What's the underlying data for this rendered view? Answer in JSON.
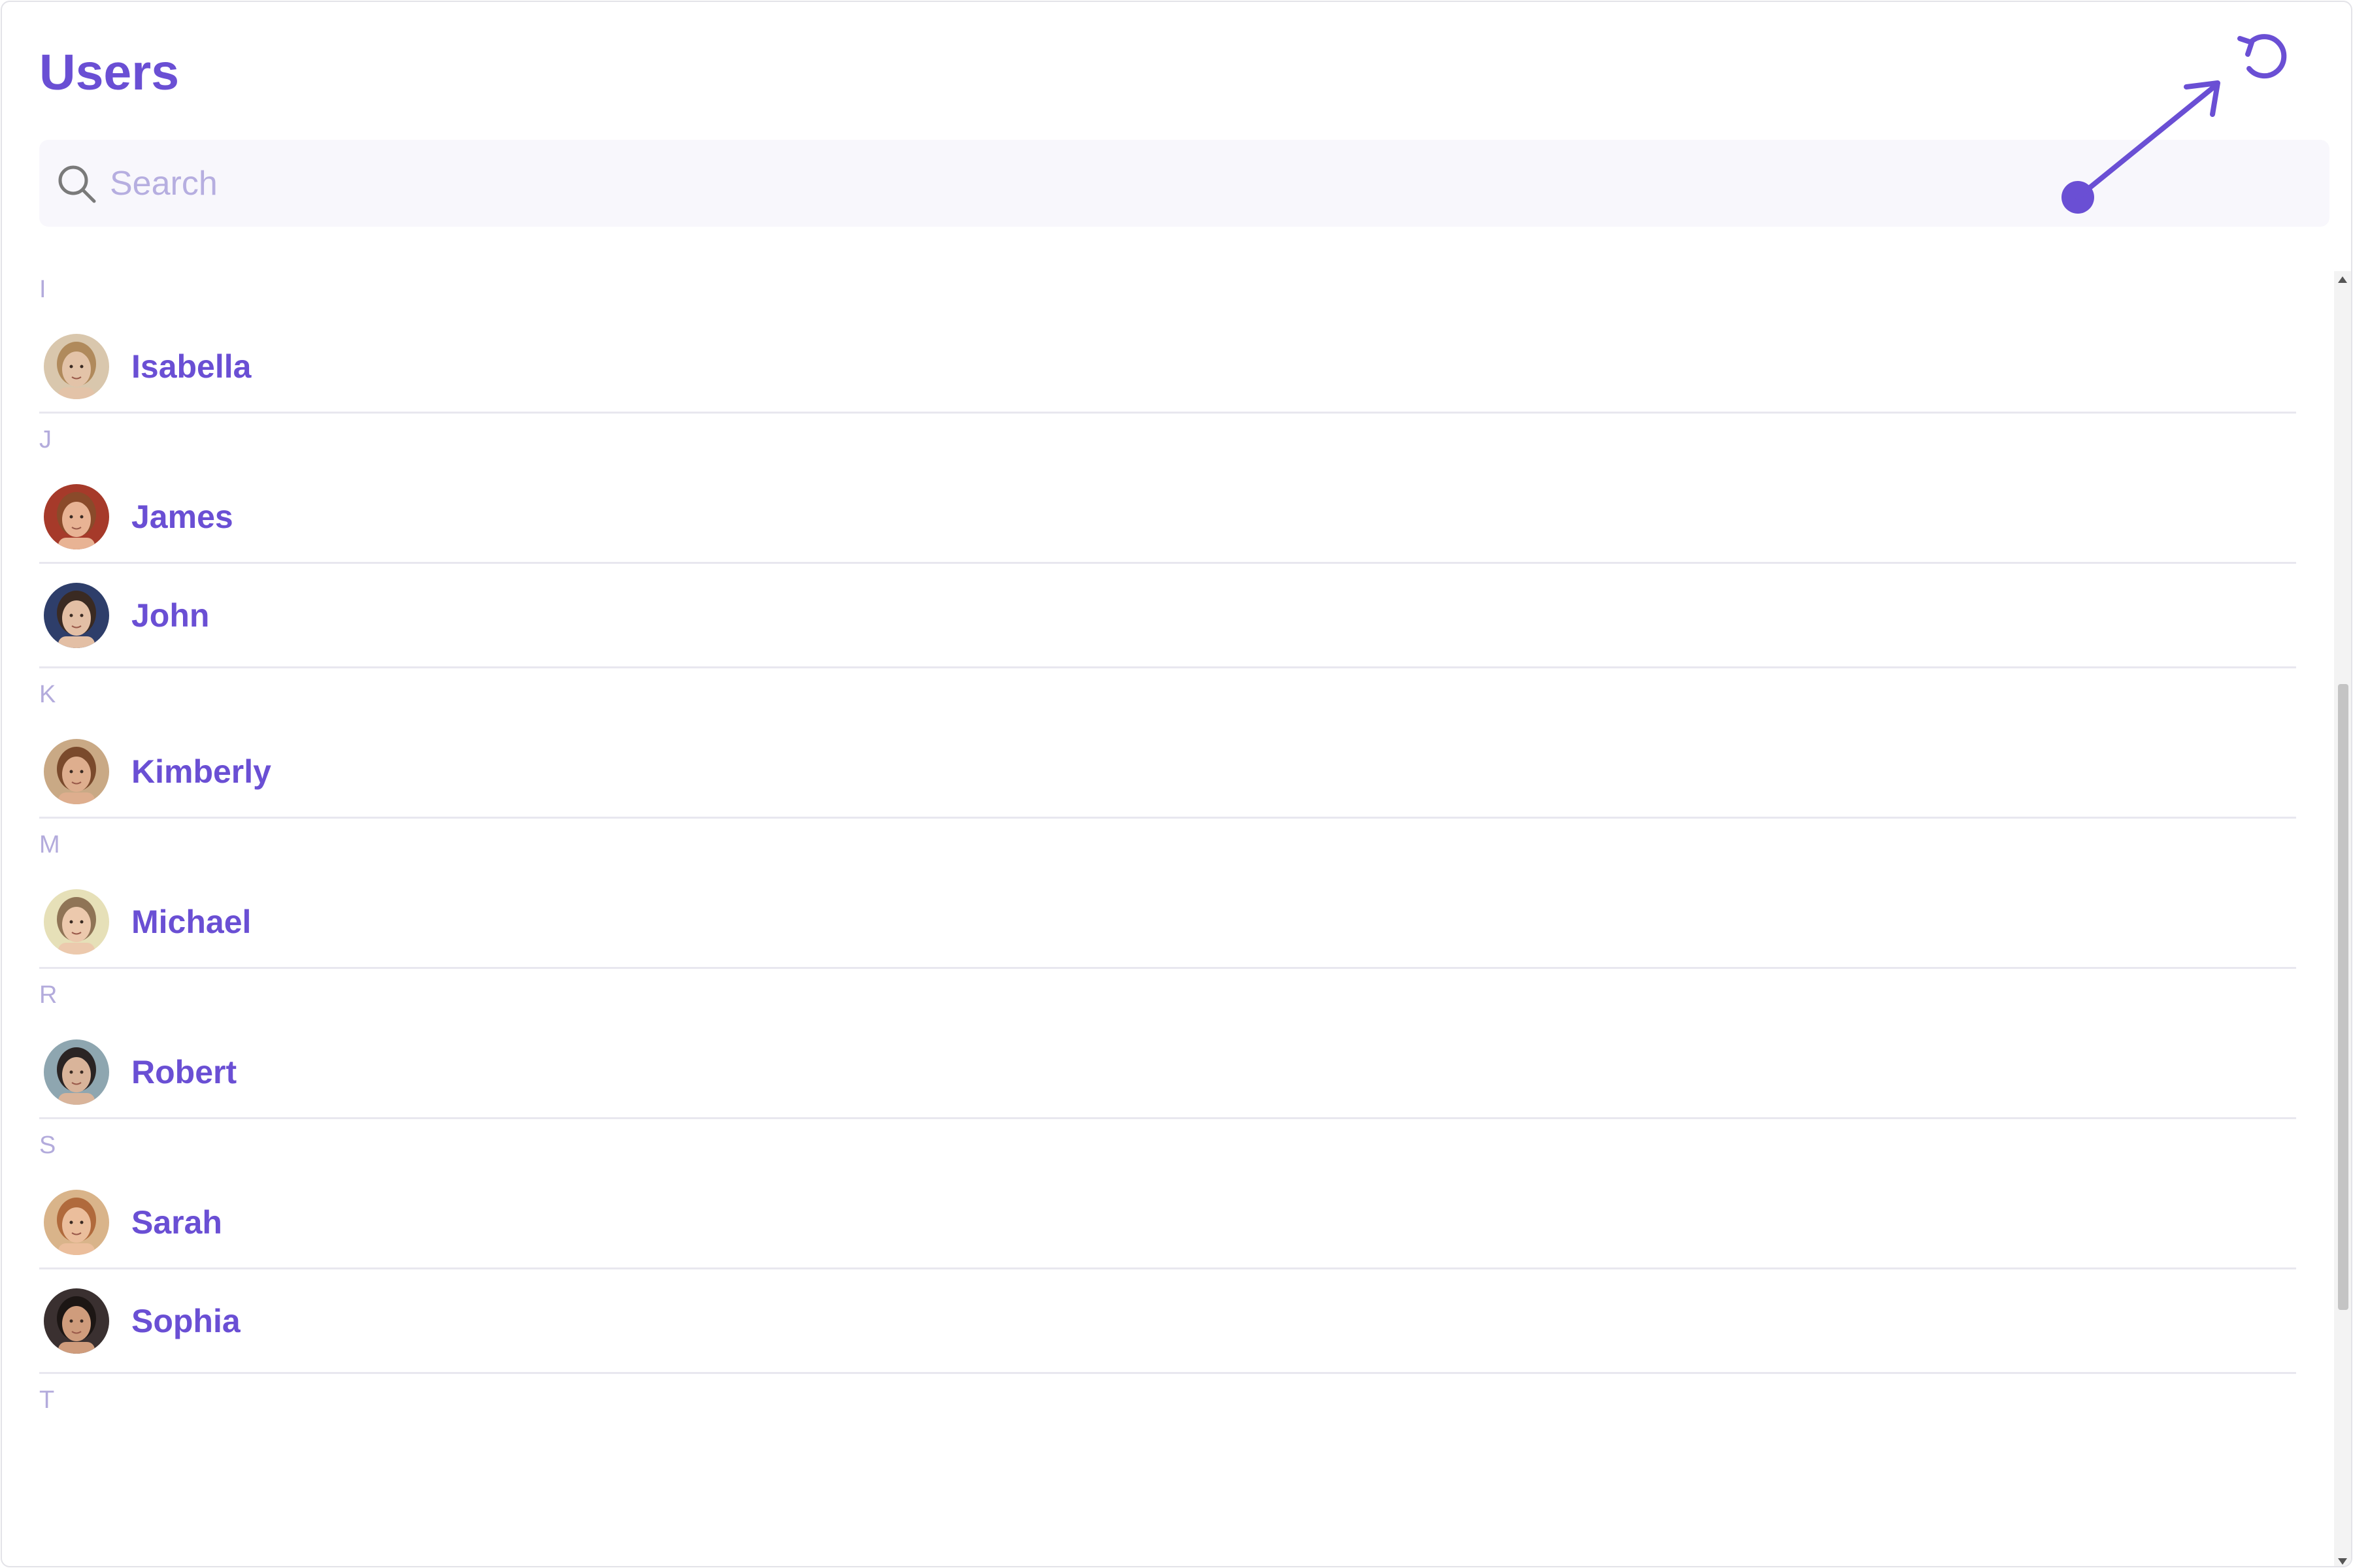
{
  "header": {
    "title": "Users",
    "refresh_icon": "refresh-icon"
  },
  "search": {
    "placeholder": "Search",
    "value": "",
    "icon": "search-icon"
  },
  "colors": {
    "accent": "#6a4fd4",
    "section_letter": "#b3abdc",
    "divider": "#e8e7ef",
    "search_bg": "#f8f7fc"
  },
  "sections": [
    {
      "letter": "I",
      "users": [
        {
          "name": "Isabella",
          "avatar": {
            "skin": "#e3c3a8",
            "hair": "#b08a5c",
            "bg": "#d9c7ad"
          }
        }
      ]
    },
    {
      "letter": "J",
      "users": [
        {
          "name": "James",
          "avatar": {
            "skin": "#e8b394",
            "hair": "#8a4a2a",
            "bg": "#a63a2a"
          }
        },
        {
          "name": "John",
          "avatar": {
            "skin": "#e3bfa5",
            "hair": "#3a2a22",
            "bg": "#2e3e6a"
          }
        }
      ]
    },
    {
      "letter": "K",
      "users": [
        {
          "name": "Kimberly",
          "avatar": {
            "skin": "#deae8e",
            "hair": "#7a4a2c",
            "bg": "#c9a985"
          }
        }
      ]
    },
    {
      "letter": "M",
      "users": [
        {
          "name": "Michael",
          "avatar": {
            "skin": "#ecc9ad",
            "hair": "#8f7456",
            "bg": "#e6e0b8"
          }
        }
      ]
    },
    {
      "letter": "R",
      "users": [
        {
          "name": "Robert",
          "avatar": {
            "skin": "#d9b49a",
            "hair": "#2a2424",
            "bg": "#8ea6b0"
          }
        }
      ]
    },
    {
      "letter": "S",
      "users": [
        {
          "name": "Sarah",
          "avatar": {
            "skin": "#ebbe9c",
            "hair": "#b06a3c",
            "bg": "#d9b48a"
          }
        },
        {
          "name": "Sophia",
          "avatar": {
            "skin": "#cf9c7c",
            "hair": "#1c1614",
            "bg": "#3a3030"
          }
        }
      ]
    },
    {
      "letter": "T",
      "users": []
    }
  ]
}
